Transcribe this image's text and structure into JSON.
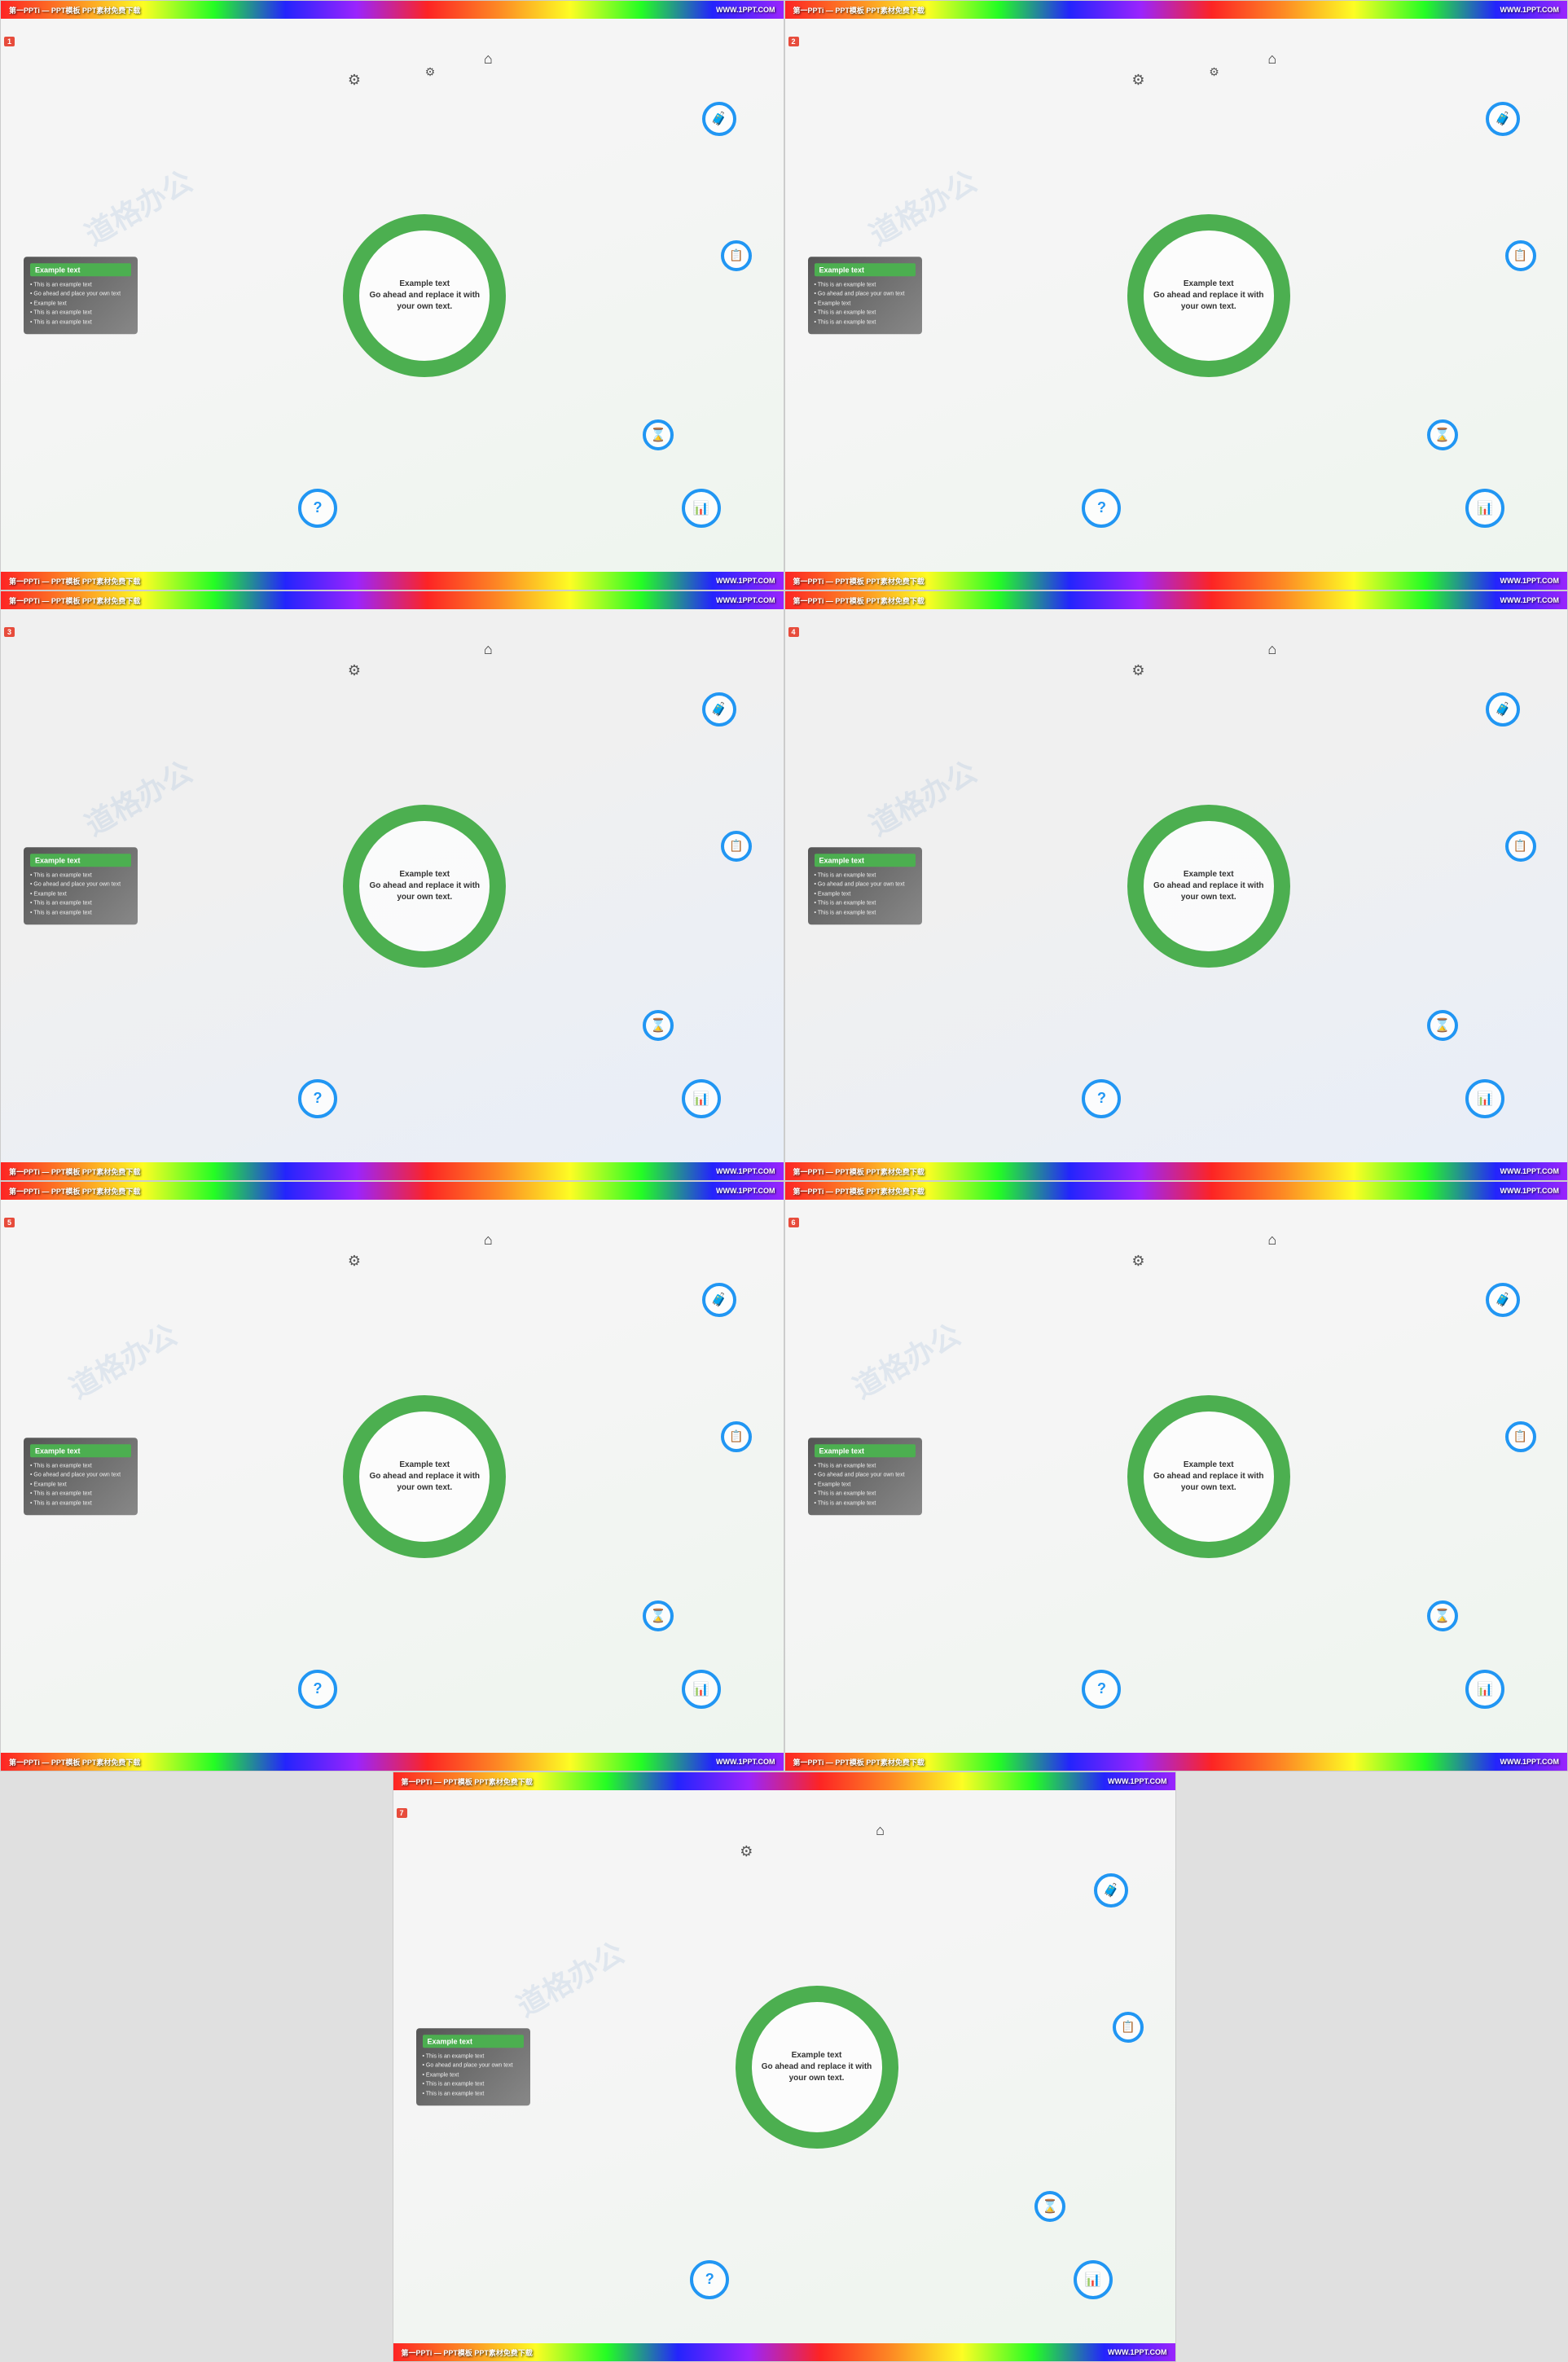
{
  "slides": [
    {
      "id": 1,
      "header_left": "第一PPTi — PPT模板 PPT素材免费下载",
      "header_right": "WWW.1PPT.COM",
      "footer_left": "第一PPTi — PPT模板 PPT素材免费下载",
      "footer_right": "WWW.1PPT.COM",
      "textbox_title": "Example text",
      "textbox_lines": [
        "• This is an example text",
        "• Go ahead and place your own text",
        "• Example text",
        "• This is an example text",
        "• This is an example text"
      ],
      "circle_title": "Example text",
      "circle_body": "Go ahead and replace it with your own text."
    },
    {
      "id": 2,
      "header_left": "第一PPTi — PPT模板 PPT素材免费下载",
      "header_right": "WWW.1PPT.COM",
      "footer_left": "第一PPTi — PPT模板 PPT素材免费下载",
      "footer_right": "WWW.1PPT.COM",
      "textbox_title": "Example text",
      "textbox_lines": [
        "• This is an example text",
        "• Go ahead and place your own text",
        "• Example text",
        "• This is an example text",
        "• This is an example text"
      ],
      "circle_title": "Example text",
      "circle_body": "Go ahead and replace it with your own text."
    },
    {
      "id": 3,
      "header_left": "第一PPTi — PPT模板 PPT素材免费下载",
      "header_right": "WWW.1PPT.COM",
      "footer_left": "第一PPTi — PPT模板 PPT素材免费下载",
      "footer_right": "WWW.1PPT.COM",
      "textbox_title": "Example text",
      "textbox_lines": [
        "• This is an example text",
        "• Go ahead and place your own text",
        "• Example text",
        "• This is an example text",
        "• This is an example text"
      ],
      "circle_title": "Example text",
      "circle_body": "Go ahead and replace it with your own text."
    },
    {
      "id": 4,
      "header_left": "第一PPTi — PPT模板 PPT素材免费下载",
      "header_right": "WWW.1PPT.COM",
      "footer_left": "第一PPTi — PPT模板 PPT素材免费下载",
      "footer_right": "WWW.1PPT.COM",
      "textbox_title": "Example text",
      "textbox_lines": [
        "• This is an example text",
        "• Go ahead and place your own text",
        "• Example text",
        "• This is an example text",
        "• This is an example text"
      ],
      "circle_title": "Example text",
      "circle_body": "Go ahead and replace it with your own text."
    },
    {
      "id": 5,
      "header_left": "第一PPTi — PPT模板 PPT素材免费下载",
      "header_right": "WWW.1PPT.COM",
      "footer_left": "第一PPTi — PPT模板 PPT素材免费下载",
      "footer_right": "WWW.1PPT.COM",
      "textbox_title": "Example text",
      "textbox_lines": [
        "• This is an example text",
        "• Go ahead and place your own text",
        "• Example text",
        "• This is an example text",
        "• This is an example text"
      ],
      "circle_title": "Example text",
      "circle_body": "Go ahead and replace it with your own text."
    },
    {
      "id": 6,
      "header_left": "第一PPTi — PPT模板 PPT素材免费下载",
      "header_right": "WWW.1PPT.COM",
      "footer_left": "第一PPTi — PPT模板 PPT素材免费下载",
      "footer_right": "WWW.1PPT.COM",
      "textbox_title": "Example text",
      "textbox_lines": [
        "• This is an example text",
        "• Go ahead and place your own text",
        "• Example text",
        "• This is an example text",
        "• This is an example text"
      ],
      "circle_title": "Example text",
      "circle_body": "Go ahead and replace it with your own text."
    },
    {
      "id": 7,
      "header_left": "第一PPTi — PPT模板 PPT素材免费下载",
      "header_right": "WWW.1PPT.COM",
      "footer_left": "第一PPTi — PPT模板 PPT素材免费下载",
      "footer_right": "WWW.1PPT.COM",
      "textbox_title": "Example text",
      "textbox_lines": [
        "• This is an example text",
        "• Go ahead and place your own text",
        "• Example text",
        "• This is an example text",
        "• This is an example text"
      ],
      "circle_title": "Example text",
      "circle_body": "Go ahead and replace it with your own text."
    }
  ],
  "watermark_text": "道格办公",
  "accent_green": "#4CAF50",
  "accent_blue": "#2196F3"
}
